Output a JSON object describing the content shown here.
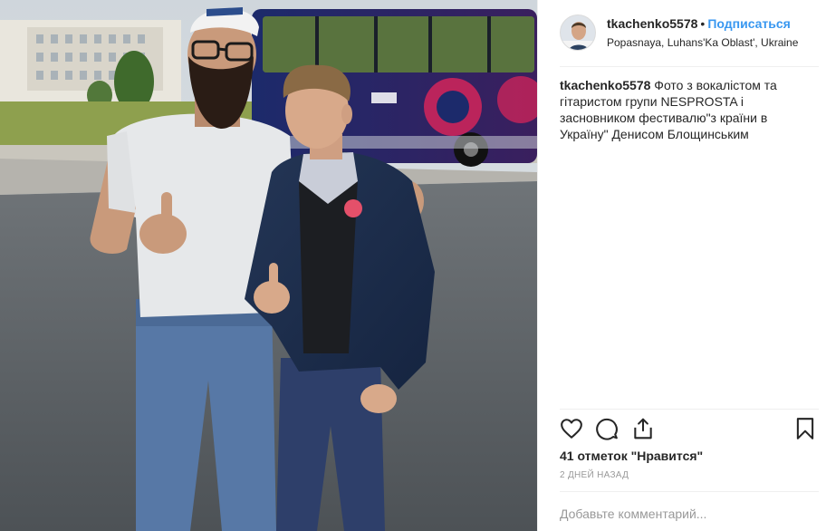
{
  "post": {
    "username": "tkachenko5578",
    "separator": "•",
    "follow_label": "Подписаться",
    "location": "Popasnaya, Luhans'Ka Oblast', Ukraine",
    "caption_user": "tkachenko5578",
    "caption_text": "Фото з вокалістом та гітаристом групи NESPROSTA і засновником фестивалю\"з країни в Україну\" Денисом Блощинським",
    "likes": "41 отметок \"Нравится\"",
    "time_ago": "2 ДНЕЙ НАЗАД",
    "comment_placeholder": "Добавьте комментарий..."
  },
  "icons": {
    "like": "heart-icon",
    "comment": "comment-bubble-icon",
    "share": "share-icon",
    "save": "bookmark-icon"
  },
  "colors": {
    "link_blue": "#3897f0",
    "text": "#262626",
    "muted": "#999999",
    "border": "#efefef"
  }
}
